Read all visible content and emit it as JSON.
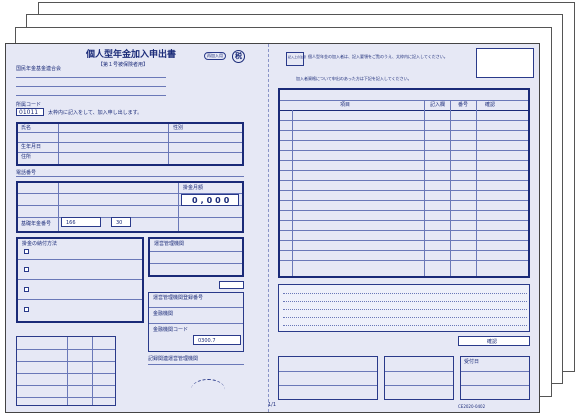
{
  "form": {
    "title": "個人型年金加入申出書",
    "subtitle": "【第１号被保険者用】",
    "badge_right": "再加入用",
    "stamp_char": "税",
    "recipient": "国民年金基金連合会",
    "code_label": "所属コード",
    "code_value": "01011",
    "instruction": "太枠内に記入をして、加入申し出します。",
    "name_label": "氏名",
    "gender_label": "性別",
    "birth_label": "生年月日",
    "address_label": "住所",
    "phone_label": "電話番号",
    "amount_label": "掛金月額",
    "amount_value": "0,000",
    "pension_no_label": "基礎年金番号",
    "pension_no_value": "166",
    "thirty": "30",
    "contribution_label": "掛金の納付方法",
    "fund_label": "運営管理機関",
    "fund_code_label": "運営管理機関登録番号",
    "institution_label": "金融機関",
    "institution_value": "0300.7",
    "institution_code_label": "金融機関コード",
    "bank_label": "記録関連運営管理機関",
    "page_no": "1/1",
    "right_header_label": "記入上の注意",
    "right_note": "個人型年金の加入者は、記入要領をご覧のうえ、太枠内に記入してください。",
    "right_note2": "加入者資格について申出のあった方は下記を記入してください。",
    "list_header_item": "項目",
    "list_header_a": "記入欄",
    "list_header_b": "番号",
    "list_header_c": "確認",
    "confirm_label": "確認",
    "footer_code": "CE2020-0402",
    "footer_label": "受付日"
  }
}
